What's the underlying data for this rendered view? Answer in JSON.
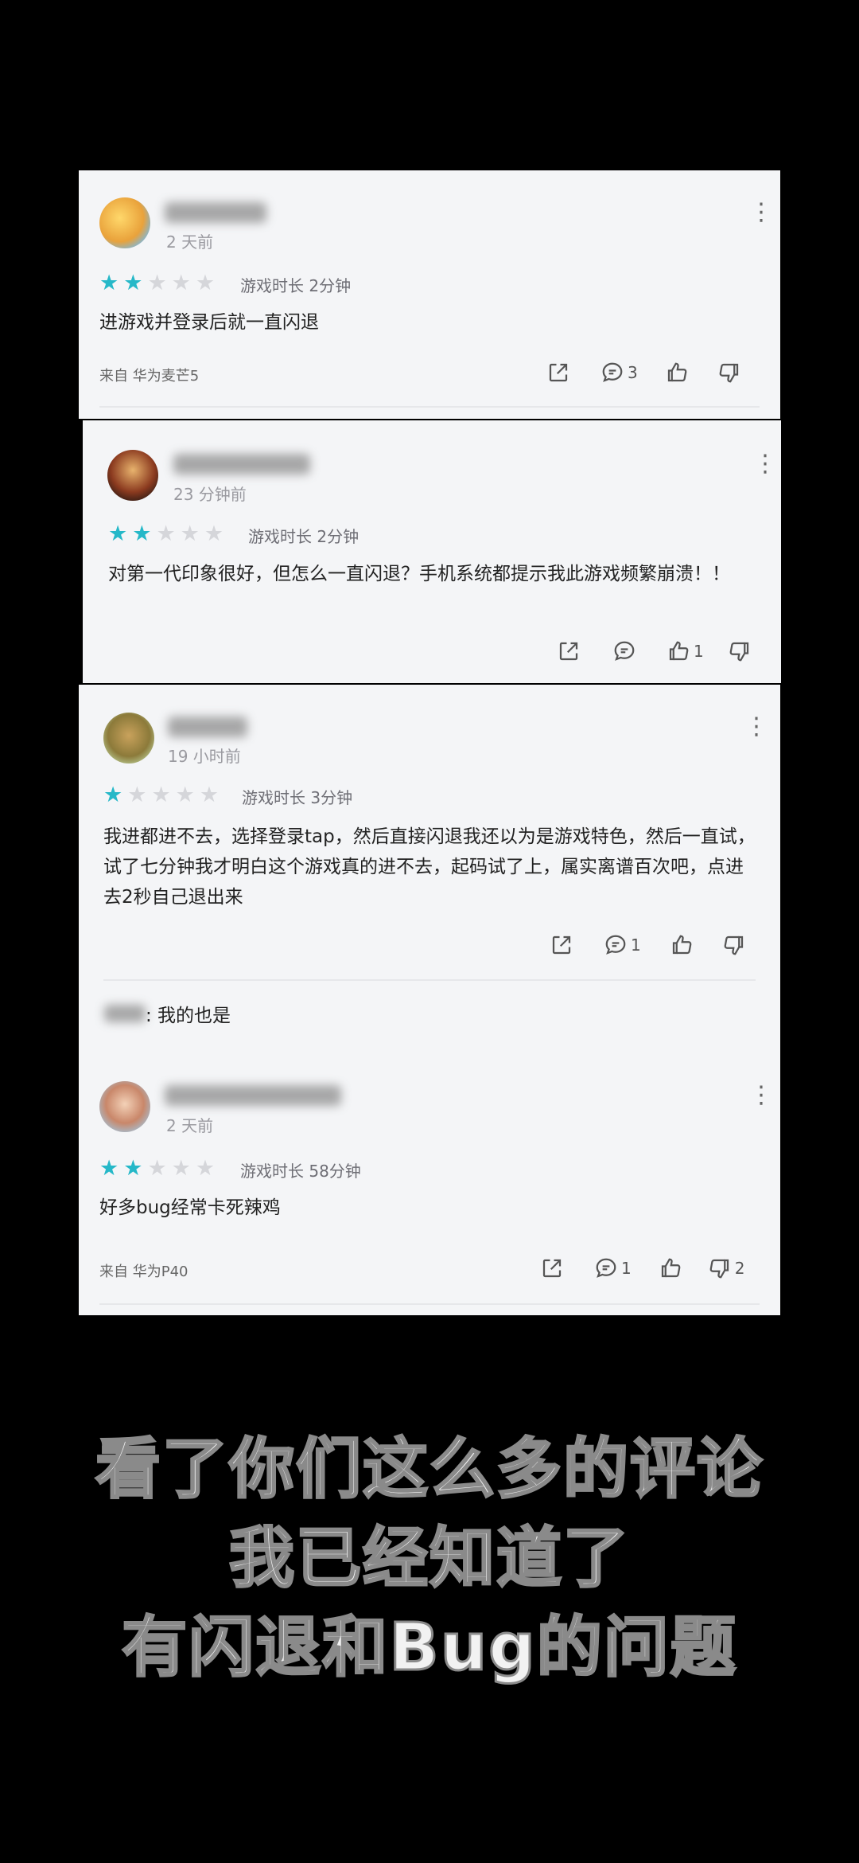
{
  "reviews": [
    {
      "time": "2 天前",
      "rating": 2,
      "playtime": "游戏时长 2分钟",
      "text": "进游戏并登录后就一直闪退",
      "device": "来自 华为麦芒5",
      "share_count": "",
      "comment_count": "3",
      "like_count": "",
      "dislike_count": ""
    },
    {
      "time": "23 分钟前",
      "rating": 2,
      "playtime": "游戏时长 2分钟",
      "text": "对第一代印象很好，但怎么一直闪退？手机系统都提示我此游戏频繁崩溃！！",
      "device": "",
      "comment_count": "",
      "like_count": "1",
      "dislike_count": ""
    },
    {
      "time": "19 小时前",
      "rating": 1,
      "playtime": "游戏时长 3分钟",
      "text": "我进都进不去，选择登录tap，然后直接闪退我还以为是游戏特色，然后一直试，试了七分钟我才明白这个游戏真的进不去，起码试了上，属实离谱百次吧，点进去2秒自己退出来",
      "device": "",
      "comment_count": "1",
      "like_count": "",
      "dislike_count": "",
      "reply": ": 我的也是"
    },
    {
      "time": "2 天前",
      "rating": 2,
      "playtime": "游戏时长 58分钟",
      "text": "好多bug经常卡死辣鸡",
      "device": "来自 华为P40",
      "comment_count": "1",
      "like_count": "",
      "dislike_count": "2"
    }
  ],
  "caption": {
    "line1": "看了你们这么多的评论",
    "line2": "我已经知道了",
    "line3": "有闪退和Bug的问题"
  },
  "colors": {
    "star_on": "#25b8c8",
    "star_off": "#d5d6da",
    "card_bg": "#f4f5f7"
  },
  "icons": [
    "share-icon",
    "comment-icon",
    "thumbs-up-icon",
    "thumbs-down-icon",
    "more-icon",
    "star-icon"
  ]
}
